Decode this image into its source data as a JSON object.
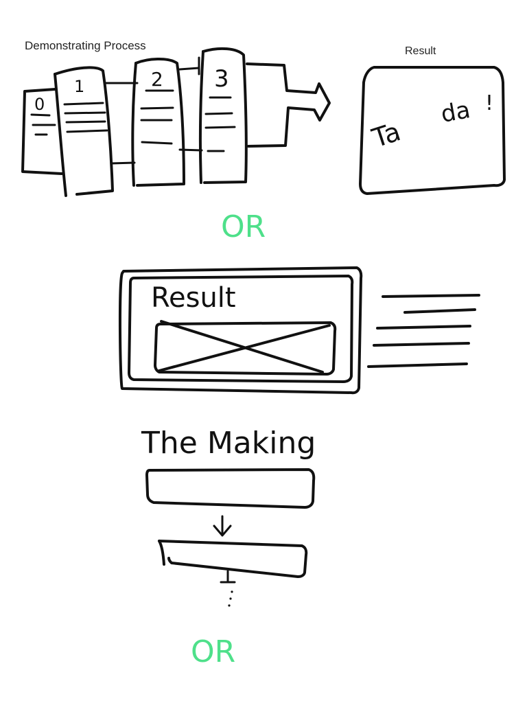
{
  "top_section": {
    "process_label": "Demonstrating Process",
    "result_label": "Result",
    "steps": [
      "0",
      "1",
      "2",
      "3"
    ],
    "result_card_text": [
      "Ta",
      "da",
      "!"
    ]
  },
  "separators": [
    "OR",
    "OR"
  ],
  "middle_section": {
    "result_heading": "Result"
  },
  "making_section": {
    "heading": "The Making"
  },
  "colors": {
    "ink": "#111111",
    "or_accent": "#4ee08a"
  }
}
